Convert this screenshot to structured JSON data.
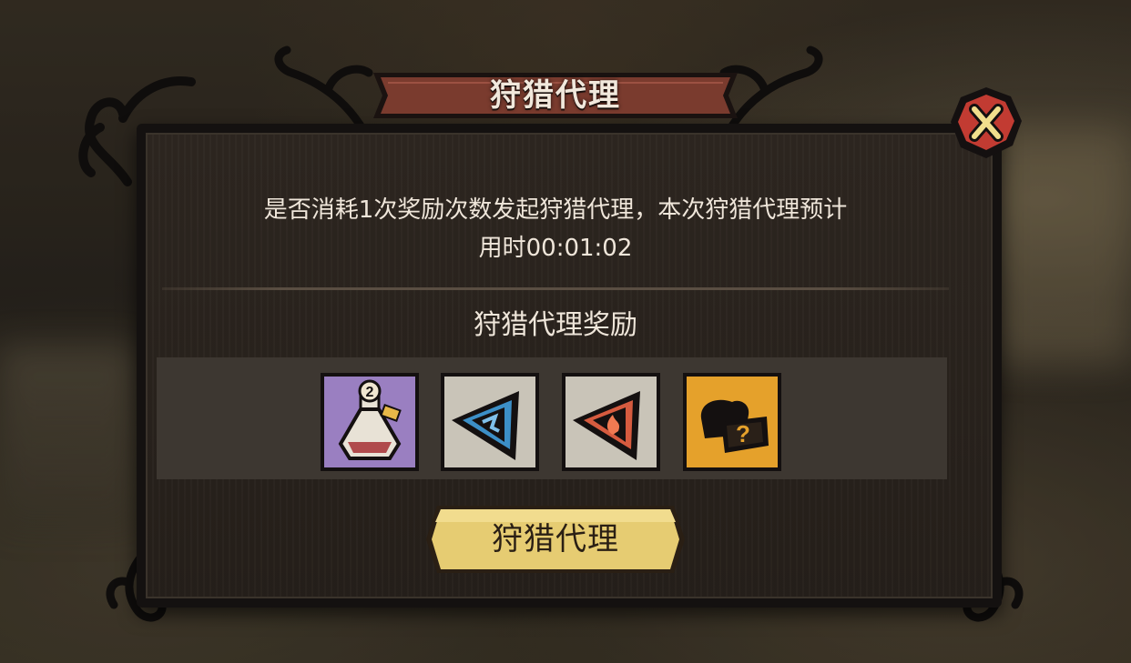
{
  "dialog": {
    "title": "狩猎代理",
    "message_line1": "是否消耗1次奖励次数发起狩猎代理，本次狩猎代理预计",
    "message_line2": "用时00:01:02",
    "rewards_heading": "狩猎代理奖励",
    "confirm_label": "狩猎代理"
  },
  "rewards": [
    {
      "icon": "potion-icon",
      "badge": "2",
      "background": "#9a7fc1"
    },
    {
      "icon": "blue-triangle-shard-icon",
      "background": "#c9c4b8"
    },
    {
      "icon": "red-triangle-shard-icon",
      "background": "#c9c4b8"
    },
    {
      "icon": "mystery-supply-bag-icon",
      "background": "#e5a12b"
    }
  ],
  "colors": {
    "banner": "#7a3b2e",
    "close_button": "#c23b32",
    "confirm_button": "#e6cc72"
  }
}
